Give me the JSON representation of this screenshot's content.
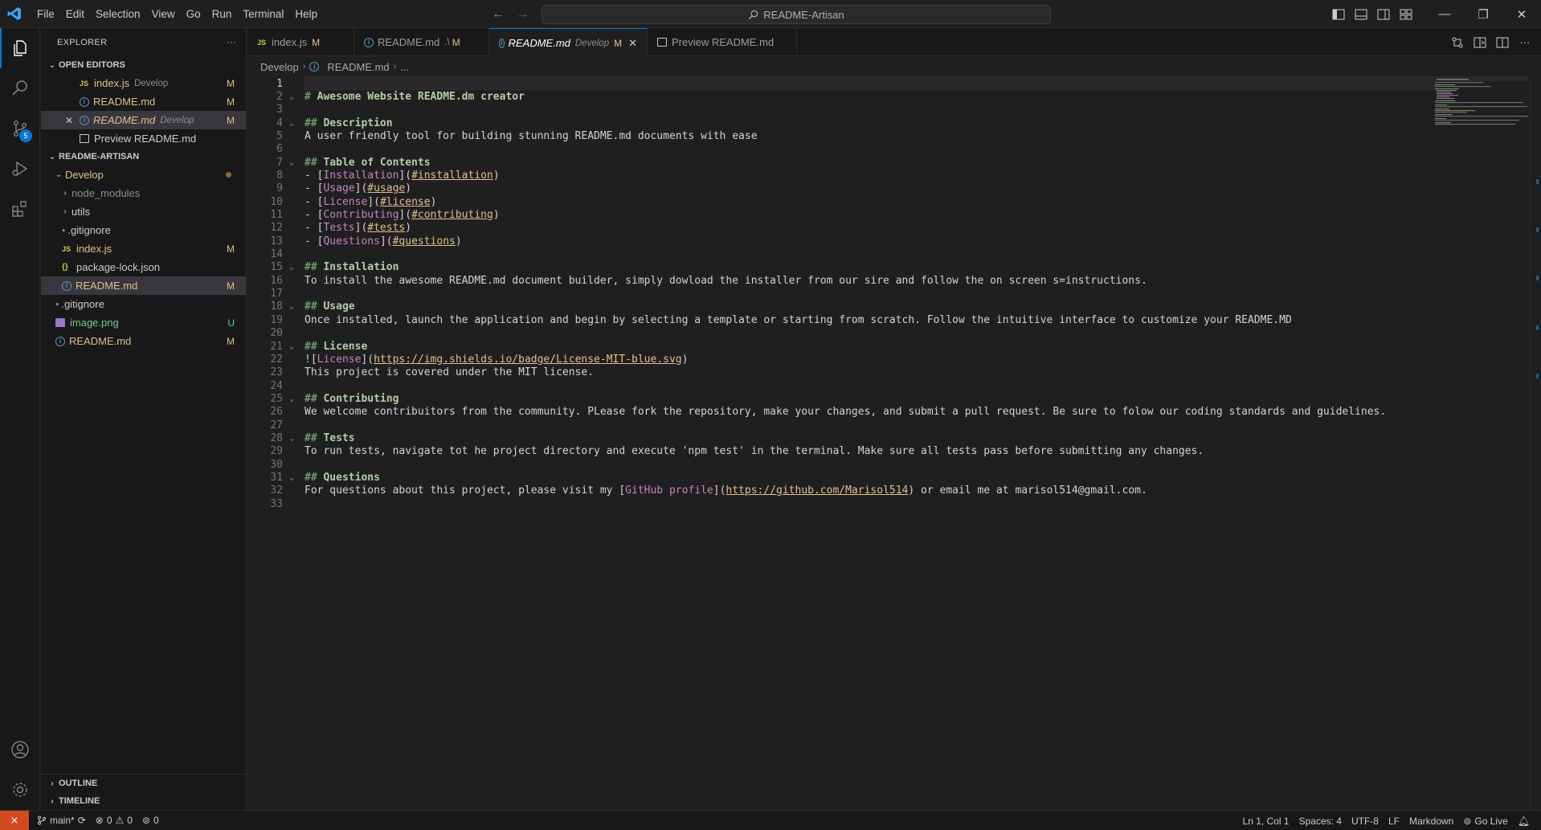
{
  "titlebar": {
    "menu": [
      "File",
      "Edit",
      "Selection",
      "View",
      "Go",
      "Run",
      "Terminal",
      "Help"
    ],
    "search_text": "README-Artisan"
  },
  "activity": {
    "scm_badge": "5"
  },
  "sidebar": {
    "title": "EXPLORER",
    "more": "···",
    "open_editors_header": "OPEN EDITORS",
    "open_editors": [
      {
        "icon": "js",
        "name": "index.js",
        "desc": "Develop",
        "status": "M"
      },
      {
        "icon": "info",
        "name": "README.md",
        "desc": "",
        "status": "M"
      },
      {
        "icon": "info",
        "name": "README.md",
        "desc": "Develop",
        "status": "M"
      },
      {
        "icon": "preview",
        "name": "Preview README.md",
        "desc": "",
        "status": ""
      }
    ],
    "project_header": "README-ARTISAN",
    "tree": {
      "develop": "Develop",
      "node_modules": "node_modules",
      "utils": "utils",
      "gitignore1": ".gitignore",
      "indexjs": "index.js",
      "indexjs_status": "M",
      "packagelock": "package-lock.json",
      "readme1": "README.md",
      "readme1_status": "M",
      "gitignore2": ".gitignore",
      "image": "image.png",
      "image_status": "U",
      "readme2": "README.md",
      "readme2_status": "M"
    },
    "outline": "OUTLINE",
    "timeline": "TIMELINE"
  },
  "tabs": [
    {
      "icon": "js",
      "label": "index.js",
      "desc": "",
      "status": "M"
    },
    {
      "icon": "info",
      "label": "README.md",
      "desc": ".\\",
      "status": "M"
    },
    {
      "icon": "info",
      "label": "README.md",
      "desc": "Develop",
      "status": "M"
    },
    {
      "icon": "preview",
      "label": "Preview README.md",
      "desc": "",
      "status": ""
    }
  ],
  "breadcrumb": {
    "folder": "Develop",
    "file": "README.md",
    "more": "..."
  },
  "code_lines": [
    "",
    "# Awesome Website README.dm creator",
    "",
    "## Description",
    "A user friendly tool for building stunning README.md documents with ease",
    "",
    "## Table of Contents",
    "- [Installation](#installation)",
    "- [Usage](#usage)",
    "- [License](#license)",
    "- [Contributing](#contributing)",
    "- [Tests](#tests)",
    "- [Questions](#questions)",
    "",
    "## Installation",
    "To install the awesome README.md document builder, simply dowload the installer from our sire and follow the on screen s=instructions.",
    "",
    "## Usage",
    "Once installed, launch the application and begin by selecting a template or starting from scratch. Follow the intuitive interface to customize your README.MD",
    "",
    "## License",
    "![License](https://img.shields.io/badge/License-MIT-blue.svg)",
    "This project is covered under the MIT license.",
    "",
    "## Contributing",
    "We welcome contribuitors from the community. PLease fork the repository, make your changes, and submit a pull request. Be sure to folow our coding standards and guidelines.",
    "",
    "## Tests",
    "To run tests, navigate tot he project directory and execute 'npm test' in the terminal. Make sure all tests pass before submitting any changes.",
    "",
    "## Questions",
    "For questions about this project, please visit my [GitHub profile](https://github.com/Marisol514) or email me at marisol514@gmail.com.",
    ""
  ],
  "statusbar": {
    "branch": "main*",
    "errors": "0",
    "warnings": "0",
    "ports": "0",
    "position": "Ln 1, Col 1",
    "spaces": "Spaces: 4",
    "encoding": "UTF-8",
    "eol": "LF",
    "language": "Markdown",
    "golive": "Go Live"
  },
  "colors": {
    "accent": "#0078d4",
    "modified": "#e2c08d",
    "untracked": "#73c991",
    "remote": "#d24a1f"
  }
}
